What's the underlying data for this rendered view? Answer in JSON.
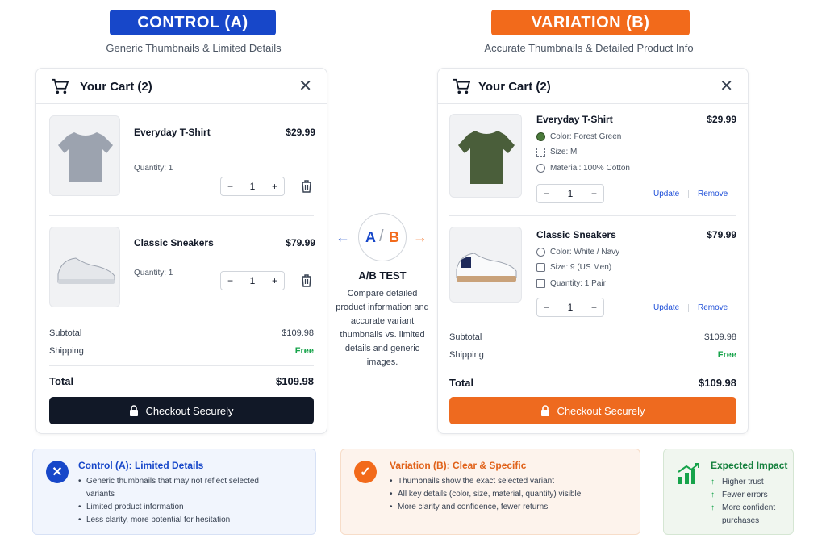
{
  "control": {
    "badge": "CONTROL (A)",
    "subtitle": "Generic Thumbnails & Limited Details",
    "cart_title": "Your Cart (2)",
    "items": [
      {
        "name": "Everyday T-Shirt",
        "price": "$29.99",
        "qty_text": "Quantity: 1",
        "qty": "1"
      },
      {
        "name": "Classic Sneakers",
        "price": "$79.99",
        "qty_text": "Quantity: 1",
        "qty": "1"
      }
    ],
    "subtotal_label": "Subtotal",
    "subtotal": "$109.98",
    "shipping_label": "Shipping",
    "shipping": "Free",
    "total_label": "Total",
    "total": "$109.98",
    "checkout": "Checkout Securely"
  },
  "variation": {
    "badge": "VARIATION (B)",
    "subtitle": "Accurate Thumbnails & Detailed Product Info",
    "cart_title": "Your Cart (2)",
    "items": [
      {
        "name": "Everyday T-Shirt",
        "price": "$29.99",
        "qty": "1",
        "attrs": [
          "Color: Forest Green",
          "Size: M",
          "Material: 100% Cotton"
        ]
      },
      {
        "name": "Classic Sneakers",
        "price": "$79.99",
        "qty": "1",
        "attrs": [
          "Color: White / Navy",
          "Size: 9 (US Men)",
          "Quantity: 1 Pair"
        ]
      }
    ],
    "update": "Update",
    "remove": "Remove",
    "subtotal_label": "Subtotal",
    "subtotal": "$109.98",
    "shipping_label": "Shipping",
    "shipping": "Free",
    "total_label": "Total",
    "total": "$109.98",
    "checkout": "Checkout Securely"
  },
  "ab": {
    "a": "A",
    "b": "B",
    "title": "A/B TEST",
    "description": "Compare detailed product information and accurate variant thumbnails vs. limited details and generic images."
  },
  "panels": {
    "control": {
      "title": "Control (A): Limited Details",
      "bullets": [
        "Generic thumbnails that may not reflect selected variants",
        "Limited product information",
        "Less clarity, more potential for hesitation"
      ]
    },
    "variation": {
      "title": "Variation (B): Clear & Specific",
      "bullets": [
        "Thumbnails show the exact selected variant",
        "All key details (color, size, material, quantity) visible",
        "More clarity and confidence, fewer returns"
      ]
    },
    "impact": {
      "title": "Expected Impact",
      "items": [
        "Higher trust",
        "Fewer errors",
        "More confident purchases"
      ]
    }
  },
  "colors": {
    "control_blue": "#1747c9",
    "variation_orange": "#f26a1b",
    "success_green": "#16a34a",
    "forest_green": "#4a5e3a"
  }
}
